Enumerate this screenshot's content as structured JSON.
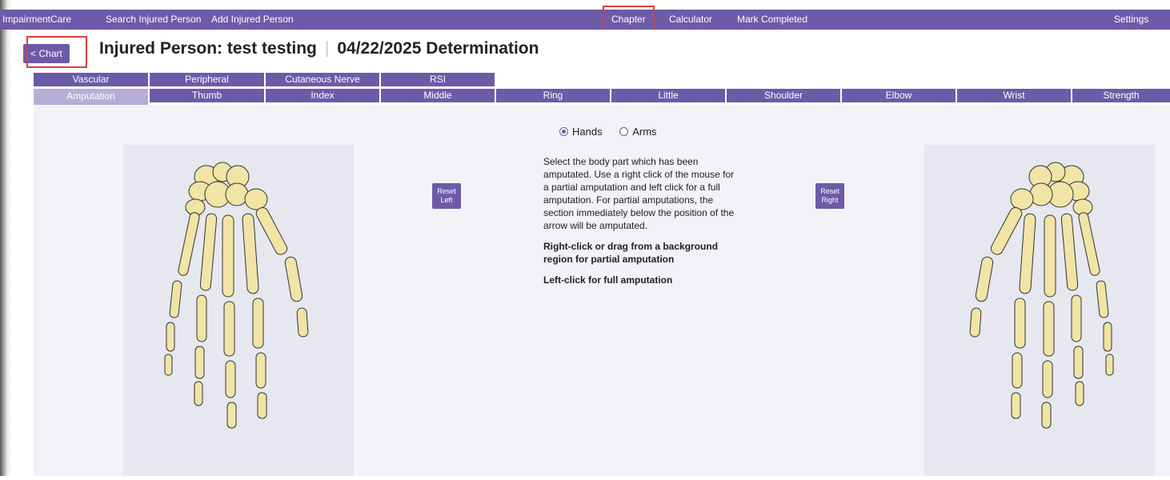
{
  "nav": {
    "brand": "ImpairmentCare",
    "search": "Search Injured Person",
    "add": "Add Injured Person",
    "chapter": "Chapter",
    "calculator": "Calculator",
    "mark_completed": "Mark Completed",
    "settings": "Settings"
  },
  "header": {
    "back_button": "< Chart",
    "title": "Injured Person: test testing",
    "determination": "04/22/2025 Determination"
  },
  "tabs": {
    "row1": [
      "Vascular",
      "Peripheral",
      "Cutaneous Nerve",
      "RSI"
    ],
    "row2": [
      "Amputation",
      "Thumb",
      "Index",
      "Middle",
      "Ring",
      "Little",
      "Shoulder",
      "Elbow",
      "Wrist",
      "Strength"
    ],
    "active": "Amputation"
  },
  "toggle": {
    "options": [
      "Hands",
      "Arms"
    ],
    "selected": "Hands"
  },
  "reset": {
    "left_line1": "Reset",
    "left_line2": "Left",
    "right_line1": "Reset",
    "right_line2": "Right"
  },
  "instructions": {
    "paragraph": "Select the body part which has been amputated. Use a right click of the mouse for a partial amputation and left click for a full amputation. For partial amputations, the section immediately below the position of the arrow will be amputated.",
    "partial": "Right-click or drag from a background region for partial amputation",
    "full": "Left-click for full amputation"
  },
  "colors": {
    "accent": "#6c5ba8",
    "active_tab": "#b7aed6",
    "highlight": "#e03a3a",
    "bone": "#f0e4a6",
    "bone_outline": "#333333"
  },
  "icons": {
    "left_hand": "hand-skeleton-left",
    "right_hand": "hand-skeleton-right"
  }
}
